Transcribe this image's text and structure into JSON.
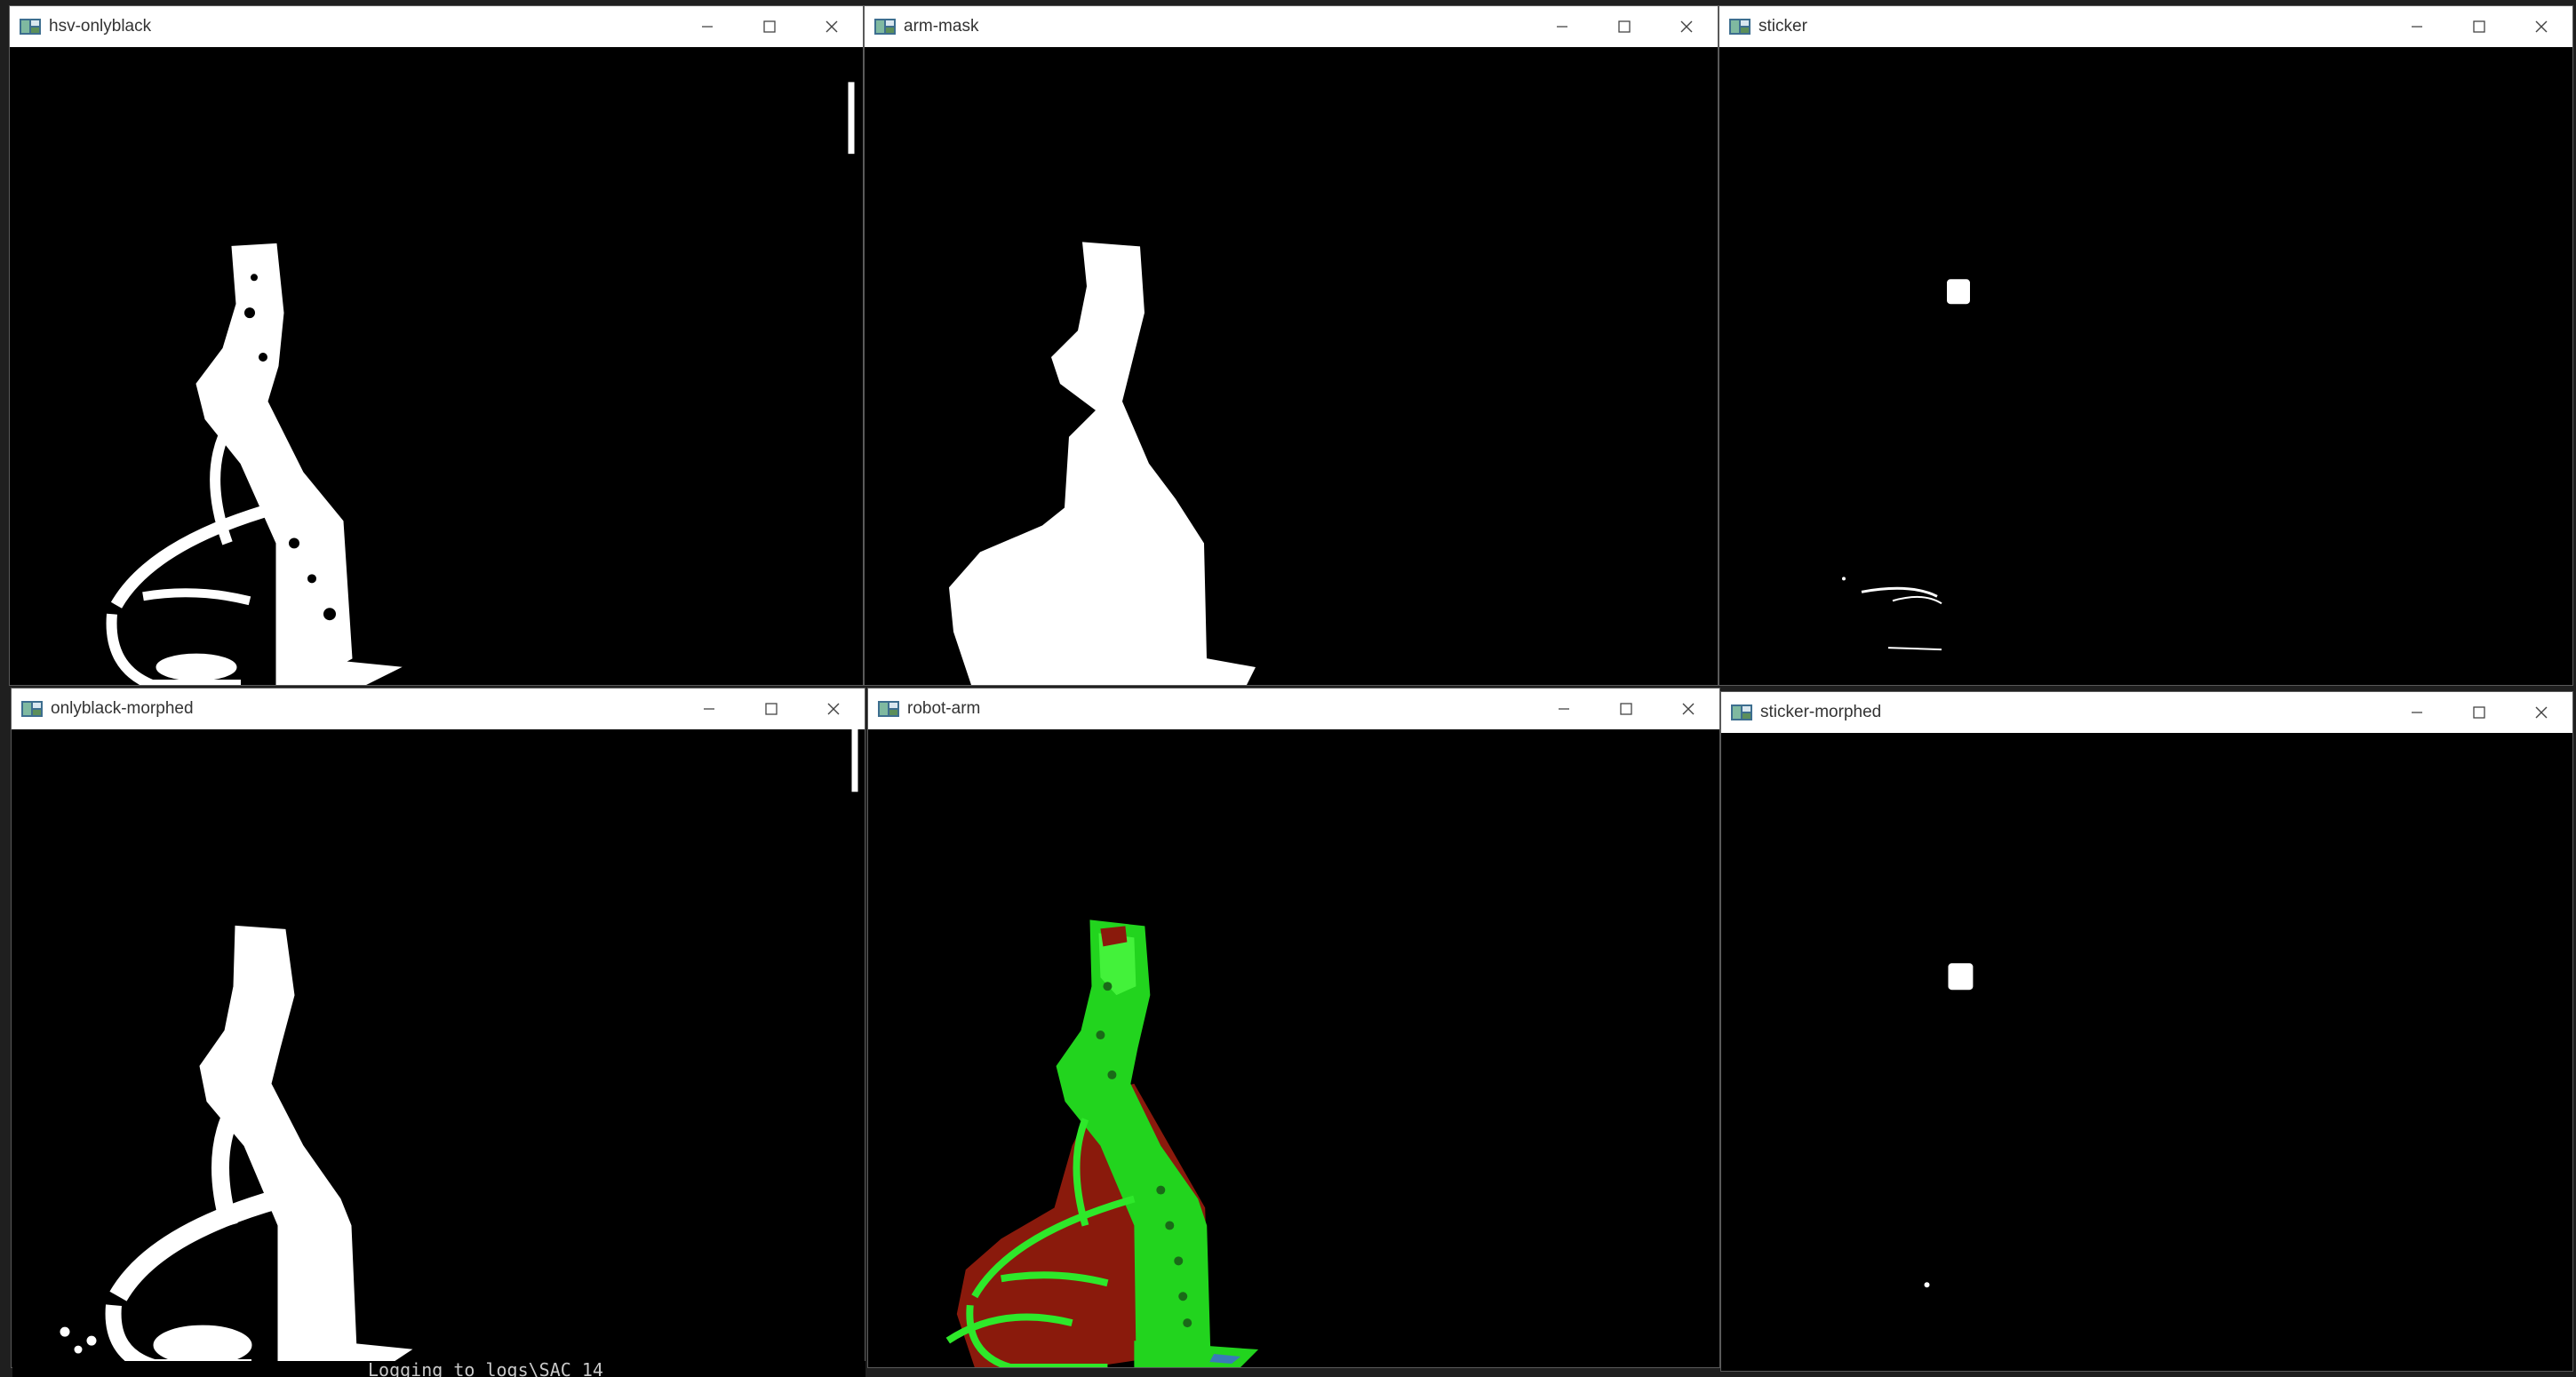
{
  "windows": [
    {
      "id": "hsv-onlyblack",
      "title": "hsv-onlyblack"
    },
    {
      "id": "arm-mask",
      "title": "arm-mask"
    },
    {
      "id": "sticker",
      "title": "sticker"
    },
    {
      "id": "onlyblack-morphed",
      "title": "onlyblack-morphed"
    },
    {
      "id": "robot-arm",
      "title": "robot-arm"
    },
    {
      "id": "sticker-morphed",
      "title": "sticker-morphed"
    }
  ],
  "controls": {
    "minimize_icon": "minimize-icon",
    "maximize_icon": "maximize-icon",
    "close_icon": "close-icon"
  },
  "terminal": {
    "text": "Logging to logs\\SAC_14"
  },
  "colors": {
    "titlebar": "#ffffff",
    "mask": "#ffffff",
    "arm_green": "#22e01f",
    "arm_red": "#8a1a0c",
    "background": "#000000"
  }
}
